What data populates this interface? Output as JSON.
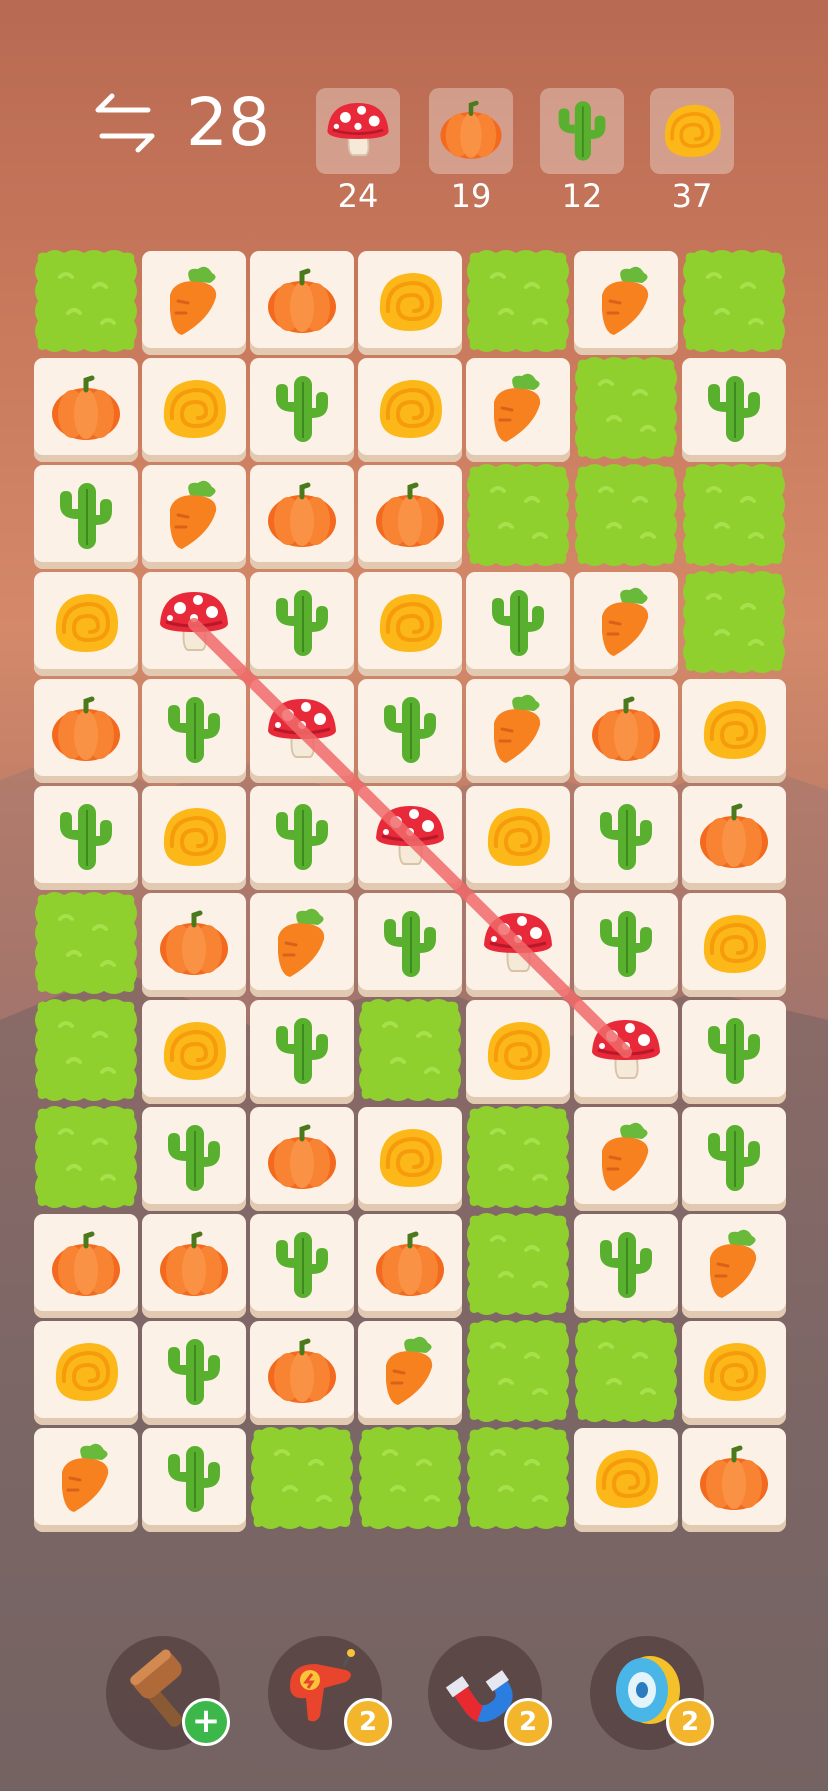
{
  "header": {
    "swap_icon": "swap-arrows-icon",
    "moves": "28",
    "goals": [
      {
        "item": "mushroom",
        "count": "24"
      },
      {
        "item": "pumpkin",
        "count": "19"
      },
      {
        "item": "cactus",
        "count": "12"
      },
      {
        "item": "snail-shell",
        "count": "37"
      }
    ]
  },
  "board": {
    "columns": 7,
    "rows": 12,
    "grid": [
      [
        "bush",
        "carrot",
        "pumpkin",
        "shell",
        "bush",
        "carrot",
        "bush"
      ],
      [
        "pumpkin",
        "shell",
        "cactus",
        "shell",
        "carrot",
        "bush",
        "cactus"
      ],
      [
        "cactus",
        "carrot",
        "pumpkin",
        "pumpkin",
        "bush",
        "bush",
        "bush"
      ],
      [
        "shell",
        "mushroom",
        "cactus",
        "shell",
        "cactus",
        "carrot",
        "bush"
      ],
      [
        "pumpkin",
        "cactus",
        "mushroom",
        "cactus",
        "carrot",
        "pumpkin",
        "shell"
      ],
      [
        "cactus",
        "shell",
        "cactus",
        "mushroom",
        "shell",
        "cactus",
        "pumpkin"
      ],
      [
        "bush",
        "pumpkin",
        "carrot",
        "cactus",
        "mushroom",
        "cactus",
        "shell"
      ],
      [
        "bush",
        "shell",
        "cactus",
        "bush",
        "shell",
        "mushroom",
        "cactus"
      ],
      [
        "bush",
        "cactus",
        "pumpkin",
        "shell",
        "bush",
        "carrot",
        "cactus"
      ],
      [
        "pumpkin",
        "pumpkin",
        "cactus",
        "pumpkin",
        "bush",
        "cactus",
        "carrot"
      ],
      [
        "shell",
        "cactus",
        "pumpkin",
        "carrot",
        "bush",
        "bush",
        "shell"
      ],
      [
        "carrot",
        "cactus",
        "bush",
        "bush",
        "bush",
        "shell",
        "pumpkin"
      ]
    ],
    "selected_chain": [
      [
        3,
        1
      ],
      [
        4,
        2
      ],
      [
        5,
        3
      ],
      [
        6,
        4
      ],
      [
        7,
        5
      ]
    ]
  },
  "boosters": [
    {
      "name": "hammer",
      "icon": "hammer-icon",
      "badge": "+"
    },
    {
      "name": "blaster",
      "icon": "ray-gun-icon",
      "badge": "2"
    },
    {
      "name": "magnet",
      "icon": "magnet-icon",
      "badge": "2"
    },
    {
      "name": "yoyo",
      "icon": "yoyo-icon",
      "badge": "2"
    }
  ],
  "colors": {
    "tile_face": "#fbf1e6",
    "bush": "#8fcf2e",
    "link": "#f06a6a",
    "badge": "#f3b52c",
    "badge_plus": "#3cb84a"
  }
}
